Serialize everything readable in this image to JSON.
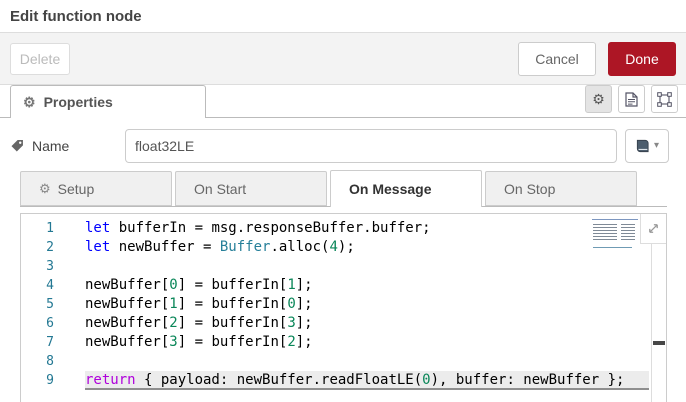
{
  "dialog": {
    "title": "Edit function node"
  },
  "toolbar": {
    "delete_label": "Delete",
    "cancel_label": "Cancel",
    "done_label": "Done"
  },
  "properties": {
    "tab_label": "Properties"
  },
  "name_field": {
    "label": "Name",
    "value": "float32LE"
  },
  "function_tabs": [
    {
      "label": "Setup",
      "active": false
    },
    {
      "label": "On Start",
      "active": false
    },
    {
      "label": "On Message",
      "active": true
    },
    {
      "label": "On Stop",
      "active": false
    }
  ],
  "editor": {
    "active_line": 9,
    "lines": [
      {
        "num": 1,
        "segments": [
          {
            "t": "let",
            "c": "kw"
          },
          {
            "t": " bufferIn = msg.responseBuffer.buffer;",
            "c": "pl"
          }
        ]
      },
      {
        "num": 2,
        "segments": [
          {
            "t": "let",
            "c": "kw"
          },
          {
            "t": " newBuffer = ",
            "c": "pl"
          },
          {
            "t": "Buffer",
            "c": "type"
          },
          {
            "t": ".alloc(",
            "c": "pl"
          },
          {
            "t": "4",
            "c": "num"
          },
          {
            "t": ");",
            "c": "pl"
          }
        ]
      },
      {
        "num": 3,
        "segments": []
      },
      {
        "num": 4,
        "segments": [
          {
            "t": "newBuffer[",
            "c": "pl"
          },
          {
            "t": "0",
            "c": "num"
          },
          {
            "t": "] = bufferIn[",
            "c": "pl"
          },
          {
            "t": "1",
            "c": "num"
          },
          {
            "t": "];",
            "c": "pl"
          }
        ]
      },
      {
        "num": 5,
        "segments": [
          {
            "t": "newBuffer[",
            "c": "pl"
          },
          {
            "t": "1",
            "c": "num"
          },
          {
            "t": "] = bufferIn[",
            "c": "pl"
          },
          {
            "t": "0",
            "c": "num"
          },
          {
            "t": "];",
            "c": "pl"
          }
        ]
      },
      {
        "num": 6,
        "segments": [
          {
            "t": "newBuffer[",
            "c": "pl"
          },
          {
            "t": "2",
            "c": "num"
          },
          {
            "t": "] = bufferIn[",
            "c": "pl"
          },
          {
            "t": "3",
            "c": "num"
          },
          {
            "t": "];",
            "c": "pl"
          }
        ]
      },
      {
        "num": 7,
        "segments": [
          {
            "t": "newBuffer[",
            "c": "pl"
          },
          {
            "t": "3",
            "c": "num"
          },
          {
            "t": "] = bufferIn[",
            "c": "pl"
          },
          {
            "t": "2",
            "c": "num"
          },
          {
            "t": "];",
            "c": "pl"
          }
        ]
      },
      {
        "num": 8,
        "segments": []
      },
      {
        "num": 9,
        "segments": [
          {
            "t": "return",
            "c": "ret"
          },
          {
            "t": " { payload: newBuffer.readFloatLE(",
            "c": "pl"
          },
          {
            "t": "0",
            "c": "num"
          },
          {
            "t": "), buffer: newBuffer };",
            "c": "pl"
          }
        ]
      }
    ]
  },
  "colors": {
    "done_bg": "#AD1625",
    "keyword": "#0000ff",
    "type": "#267f99",
    "control": "#af00db",
    "number": "#098658",
    "text": "#000000",
    "line_number": "#237893"
  }
}
